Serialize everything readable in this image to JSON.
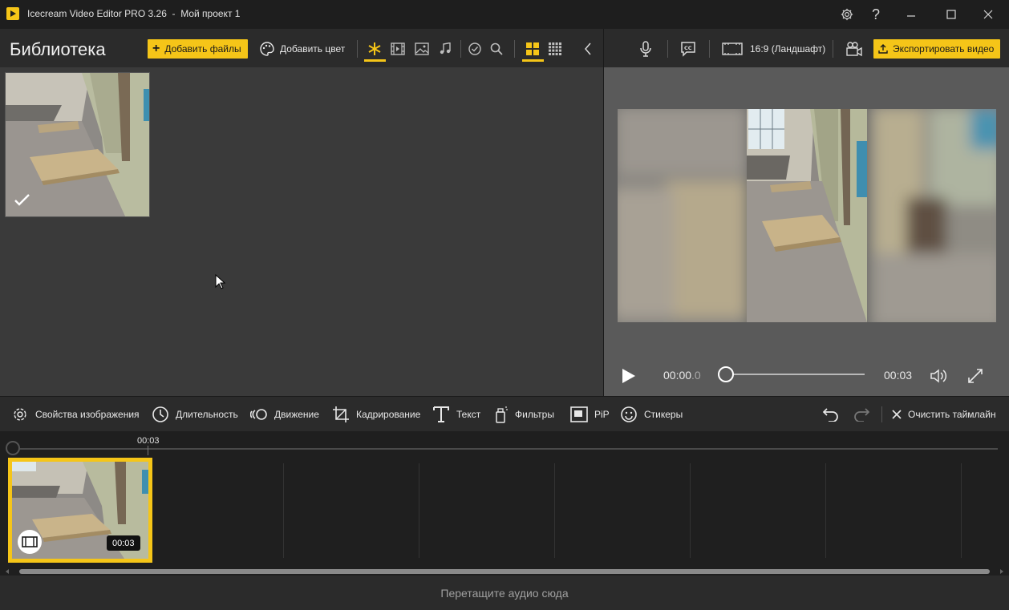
{
  "window": {
    "title": "Icecream Video Editor PRO 3.26  -  Мой проект 1"
  },
  "library": {
    "title": "Библиотека",
    "add_files_label": "Добавить файлы",
    "add_color_label": "Добавить цвет"
  },
  "preview": {
    "aspect_label": "16:9 (Ландшафт)",
    "export_label": "Экспортировать видео",
    "current_time": "00:00",
    "current_time_fraction": ".0",
    "total_time": "00:03"
  },
  "tools": {
    "image_properties": "Свойства изображения",
    "duration": "Длительность",
    "motion": "Движение",
    "crop": "Кадрирование",
    "text": "Текст",
    "filters": "Фильтры",
    "pip": "PiP",
    "stickers": "Стикеры",
    "clear_timeline": "Очистить таймлайн"
  },
  "timeline": {
    "ruler_mark": "00:03",
    "clip_duration": "00:03"
  },
  "audio_zone": {
    "hint": "Перетащите аудио сюда"
  },
  "colors": {
    "accent": "#f5c518",
    "titlebar": "#1e1e1e",
    "panel": "#2b2b2b",
    "library_bg": "#3a3a3a",
    "preview_bg": "#5a5a5a"
  }
}
